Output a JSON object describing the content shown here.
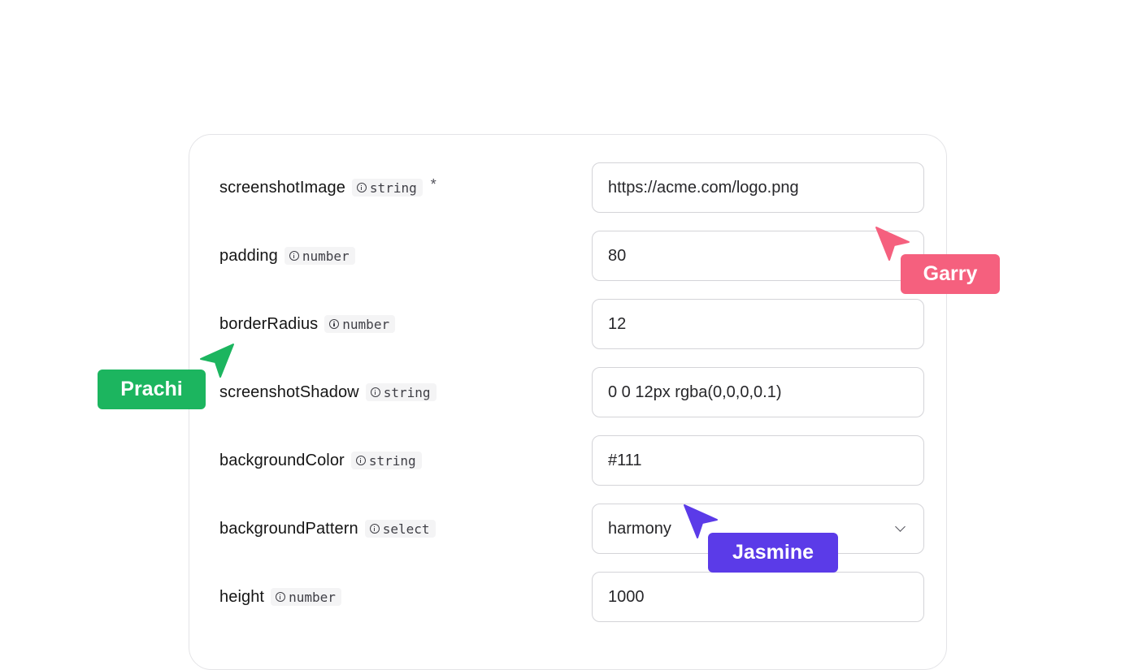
{
  "form": {
    "fields": [
      {
        "name": "screenshotImage",
        "type": "string",
        "required_mark": "*",
        "value": "https://acme.com/logo.png"
      },
      {
        "name": "padding",
        "type": "number",
        "value": "80"
      },
      {
        "name": "borderRadius",
        "type": "number",
        "value": "12"
      },
      {
        "name": "screenshotShadow",
        "type": "string",
        "value": "0 0 12px rgba(0,0,0,0.1)"
      },
      {
        "name": "backgroundColor",
        "type": "string",
        "value": "#111"
      },
      {
        "name": "backgroundPattern",
        "type": "select",
        "value": "harmony"
      },
      {
        "name": "height",
        "type": "number",
        "value": "1000"
      }
    ]
  },
  "collaborators": [
    {
      "name": "Garry",
      "color": "#f5607e"
    },
    {
      "name": "Prachi",
      "color": "#1cb55f"
    },
    {
      "name": "Jasmine",
      "color": "#5b3be8"
    }
  ],
  "icons": {
    "type_info": "info-icon",
    "select_toggle": "chevron-down-icon",
    "cursor": "cursor-arrow-icon"
  }
}
